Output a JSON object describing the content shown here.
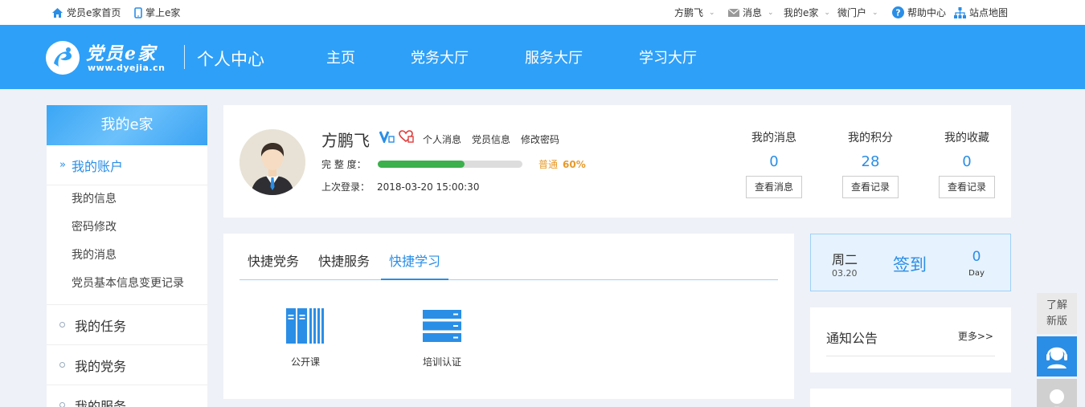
{
  "topbar": {
    "home_link": "党员e家首页",
    "mobile_link": "掌上e家",
    "user": "方鹏飞",
    "messages": "消息",
    "my_ejia": "我的e家",
    "micro_portal": "微门户",
    "help": "帮助中心",
    "sitemap": "站点地图"
  },
  "header": {
    "logo_script": "党员e家",
    "logo_url": "www.dyejia.cn",
    "title": "个人中心",
    "nav": [
      "主页",
      "党务大厅",
      "服务大厅",
      "学习大厅"
    ]
  },
  "sidebar": {
    "title": "我的e家",
    "account_section": "我的账户",
    "account_items": [
      "我的信息",
      "密码修改",
      "我的消息",
      "党员基本信息变更记录"
    ],
    "sections": [
      "我的任务",
      "我的党务",
      "我的服务"
    ]
  },
  "profile": {
    "name": "方鹏飞",
    "links": [
      "个人消息",
      "党员信息",
      "修改密码"
    ],
    "completeness_label": "完 整 度：",
    "completeness_percent": 60,
    "level_text": "普通",
    "level_value": "60%",
    "last_login_label": "上次登录：",
    "last_login": "2018-03-20 15:00:30",
    "stats": [
      {
        "label": "我的消息",
        "value": "0",
        "button": "查看消息"
      },
      {
        "label": "我的积分",
        "value": "28",
        "button": "查看记录"
      },
      {
        "label": "我的收藏",
        "value": "0",
        "button": "查看记录"
      }
    ]
  },
  "quick": {
    "tabs": [
      "快捷党务",
      "快捷服务",
      "快捷学习"
    ],
    "active_tab": 2,
    "items": [
      {
        "label": "公开课",
        "icon": "books-icon"
      },
      {
        "label": "培训认证",
        "icon": "server-stack-icon"
      }
    ]
  },
  "signin": {
    "weekday": "周二",
    "date": "03.20",
    "button": "签到",
    "count": "0",
    "unit": "Day"
  },
  "notice": {
    "title": "通知公告",
    "more": "更多>>"
  },
  "float": {
    "new_version": "了解新版"
  },
  "colors": {
    "brand_blue": "#2fa0f7",
    "accent_blue": "#2a8ee6",
    "progress_green": "#3bb04c",
    "level_orange": "#e69a2b"
  }
}
